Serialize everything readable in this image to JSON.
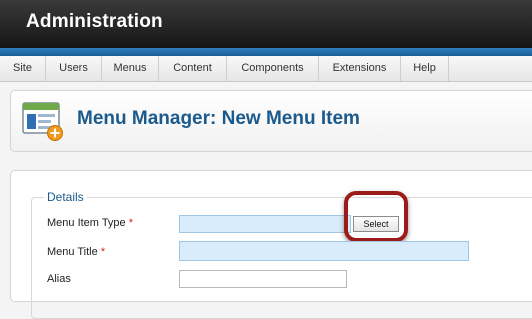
{
  "header": {
    "title": "Administration"
  },
  "menu": {
    "items": [
      "Site",
      "Users",
      "Menus",
      "Content",
      "Components",
      "Extensions",
      "Help"
    ]
  },
  "page": {
    "title": "Menu Manager: New Menu Item",
    "icon": "menu-manager-add-icon"
  },
  "form": {
    "legend": "Details",
    "fields": [
      {
        "label": "Menu Item Type",
        "required": "*",
        "value": "",
        "button_label": "Select"
      },
      {
        "label": "Menu Title",
        "required": "*",
        "value": ""
      },
      {
        "label": "Alias",
        "value": ""
      }
    ]
  },
  "colors": {
    "header_bg": "#1e1e1e",
    "accent_strip": "#2a76b5",
    "title_blue": "#1b5a8c",
    "input_bg": "#d9ecfb",
    "highlight": "#9b1b1b",
    "required_star": "#d92323"
  }
}
